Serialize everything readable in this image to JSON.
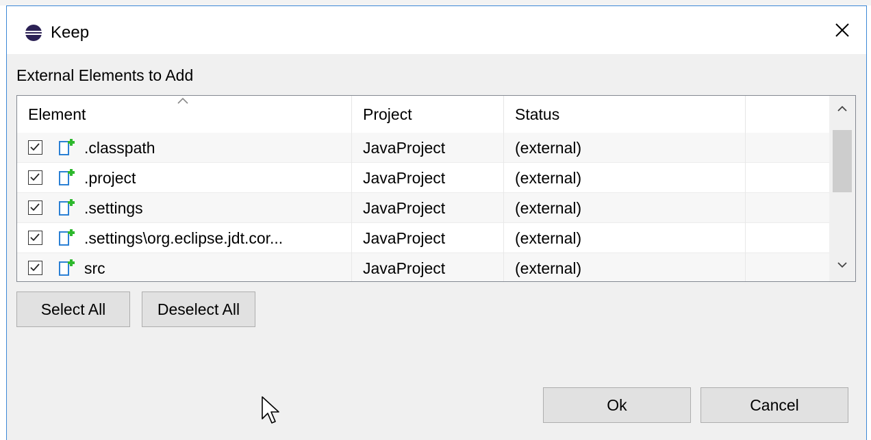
{
  "dialog": {
    "title": "Keep",
    "app_icon": "eclipse-icon",
    "close_icon": "close-icon"
  },
  "section_label": "External Elements to Add",
  "table": {
    "columns": [
      "Element",
      "Project",
      "Status"
    ],
    "rows": [
      {
        "checked": true,
        "element": ".classpath",
        "project": "JavaProject",
        "status": "(external)"
      },
      {
        "checked": true,
        "element": ".project",
        "project": "JavaProject",
        "status": "(external)"
      },
      {
        "checked": true,
        "element": ".settings",
        "project": "JavaProject",
        "status": "(external)"
      },
      {
        "checked": true,
        "element": ".settings\\org.eclipse.jdt.cor...",
        "project": "JavaProject",
        "status": "(external)"
      },
      {
        "checked": true,
        "element": "src",
        "project": "JavaProject",
        "status": "(external)"
      }
    ]
  },
  "buttons": {
    "select_all": "Select All",
    "deselect_all": "Deselect All",
    "ok": "Ok",
    "cancel": "Cancel"
  },
  "colors": {
    "accent": "#3a87d6",
    "file_icon_blue": "#2a7fd4",
    "file_icon_green": "#2eb82e"
  }
}
